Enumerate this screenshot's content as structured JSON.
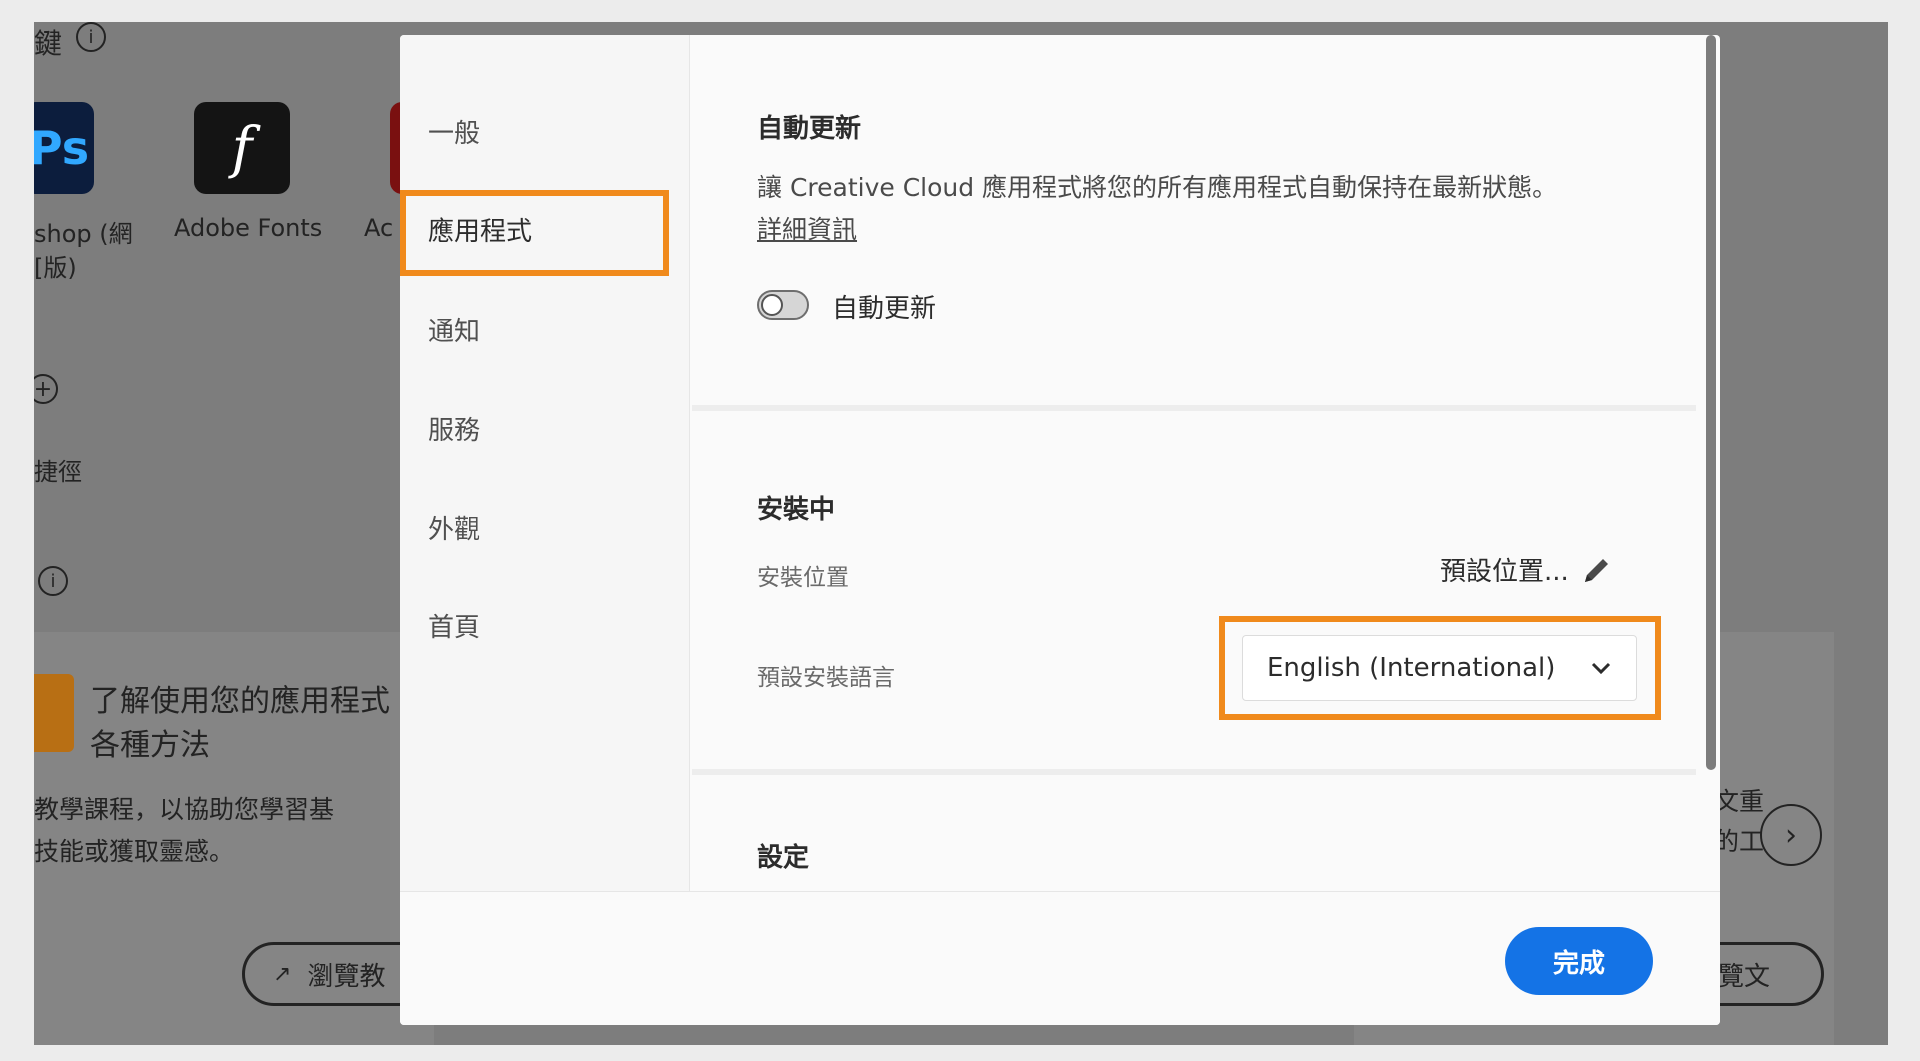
{
  "background": {
    "top_fragment": "鍵",
    "apps": [
      {
        "name": "Ps",
        "label_line1": "shop (網",
        "label_line2": "[版)"
      },
      {
        "name": "f",
        "label_line1": "Adobe Fonts",
        "label_line2": ""
      },
      {
        "name": "",
        "label_line1": "Ac",
        "label_line2": ""
      }
    ],
    "shortcut_label": "捷徑",
    "learn_title_line1": "了解使用您的應用程式",
    "learn_title_line2": "各種方法",
    "learn_desc_line1": "教學課程，以協助您學習基",
    "learn_desc_line2": "技能或獲取靈感。",
    "browse_button": "瀏覽教",
    "right_fragment_1": "文重",
    "right_fragment_2": "的工",
    "right_button": "覽文"
  },
  "sidebar": {
    "items": [
      {
        "label": "一般"
      },
      {
        "label": "應用程式"
      },
      {
        "label": "通知"
      },
      {
        "label": "服務"
      },
      {
        "label": "外觀"
      },
      {
        "label": "首頁"
      }
    ],
    "selected_index": 1
  },
  "auto_update": {
    "title": "自動更新",
    "description": "讓 Creative Cloud 應用程式將您的所有應用程式自動保持在最新狀態。",
    "link": "詳細資訊",
    "toggle_label": "自動更新",
    "toggle_on": false
  },
  "installing": {
    "title": "安裝中",
    "location_label": "安裝位置",
    "location_value": "預設位置...",
    "language_label": "預設安裝語言",
    "language_value": "English (International)"
  },
  "settings": {
    "title": "設定"
  },
  "footer": {
    "done_label": "完成"
  },
  "colors": {
    "accent_blue": "#1473e6",
    "highlight_orange": "#f08a1c"
  }
}
